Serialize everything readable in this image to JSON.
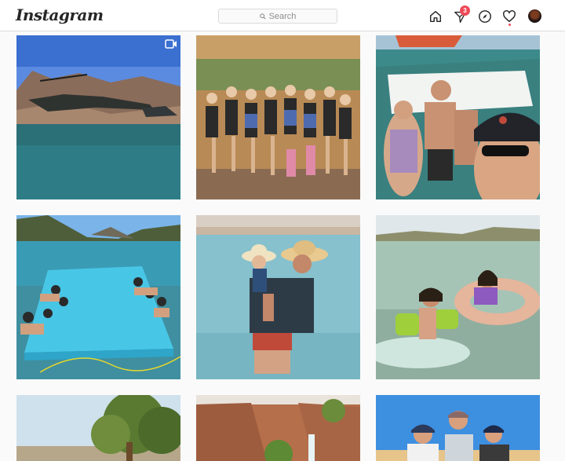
{
  "nav": {
    "logo": "Instagram",
    "search_placeholder": "Search",
    "icons": [
      "home-icon",
      "direct-icon",
      "explore-icon",
      "activity-heart-icon",
      "profile-avatar"
    ],
    "direct_badge": "3",
    "badge_color": "#ed4956"
  },
  "grid": {
    "columns": 3,
    "posts": [
      {
        "subject": "helicopter over lake",
        "is_video": true
      },
      {
        "subject": "group photo on beach"
      },
      {
        "subject": "selfie on boat"
      },
      {
        "subject": "floating mat on lake"
      },
      {
        "subject": "man holding baby in water"
      },
      {
        "subject": "kids on floats"
      },
      {
        "subject": "tree by shore"
      },
      {
        "subject": "canyon waterfall"
      },
      {
        "subject": "three people selfie"
      }
    ]
  }
}
